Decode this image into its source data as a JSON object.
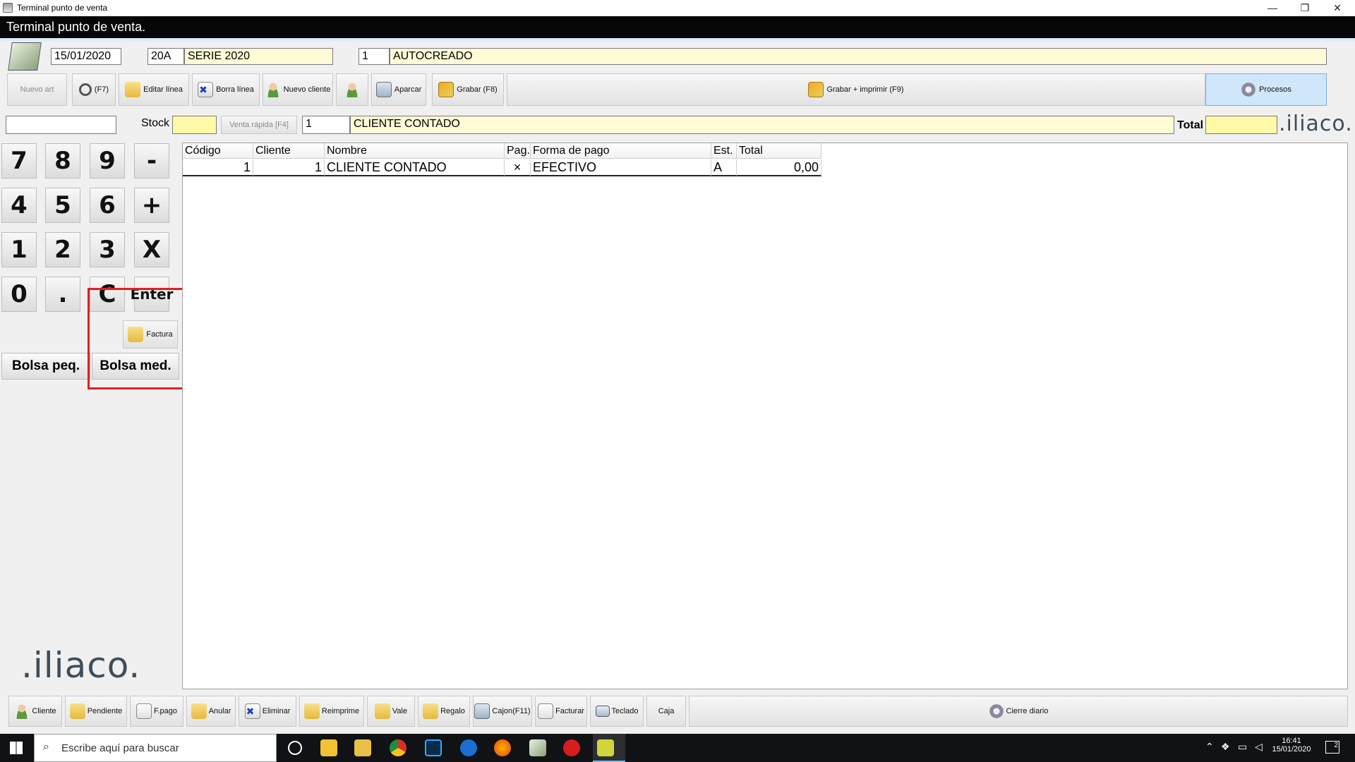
{
  "window": {
    "title": "Terminal punto de venta",
    "minimize": "—",
    "restore": "❐",
    "close": "✕"
  },
  "header": {
    "title": "Terminal punto de venta."
  },
  "doc": {
    "date": "15/01/2020",
    "serie_code": "20A",
    "serie_name": "SERIE 2020",
    "number": "1",
    "status_text": "AUTOCREADO"
  },
  "toolbar": {
    "nuevo_art": "Nuevo art",
    "f7": "(F7)",
    "editar_linea": "Editar línea",
    "borra_linea": "Borra línea",
    "nuevo_cliente": "Nuevo cliente",
    "aparcar": "Aparcar",
    "grabar": "Grabar (F8)",
    "grabar_imprimir": "Grabar + imprimir (F9)",
    "procesos": "Procesos"
  },
  "row2": {
    "code_value": "",
    "stock_label": "Stock",
    "stock_value": "",
    "venta_rapida": "Venta rápida [F4]",
    "client_code": "1",
    "client_name": "CLIENTE CONTADO",
    "total_label": "Total",
    "total_value": "",
    "logo": ".iliaco."
  },
  "keypad": {
    "keys": [
      "7",
      "8",
      "9",
      "-",
      "4",
      "5",
      "6",
      "+",
      "1",
      "2",
      "3",
      "X",
      "0",
      ".",
      "C",
      "Enter"
    ],
    "factura": "Factura",
    "bolsa_peq": "Bolsa peq.",
    "bolsa_med": "Bolsa med."
  },
  "grid": {
    "headers": [
      "Código",
      "Cliente",
      "Nombre",
      "Pag.",
      "Forma de pago",
      "Est.",
      "Total"
    ],
    "rows": [
      {
        "codigo": "1",
        "cliente": "1",
        "nombre": "CLIENTE CONTADO",
        "pag": "×",
        "forma": "EFECTIVO",
        "est": "A",
        "total": "0,00"
      }
    ]
  },
  "left_logo": ".iliaco.",
  "bottom": {
    "cliente": "Cliente",
    "pendiente": "Pendiente",
    "fpago": "F.pago",
    "anular": "Anular",
    "eliminar": "Eliminar",
    "reimprime": "Reimprime",
    "vale": "Vale",
    "regalo": "Regalo",
    "cajon": "Cajon(F11)",
    "facturar": "Facturar",
    "teclado": "Teclado",
    "caja": "Caja",
    "cierre": "Cierre diario"
  },
  "taskbar": {
    "search_placeholder": "Escribe aquí para buscar",
    "time": "16:41",
    "date": "15/01/2020",
    "notif": "2"
  },
  "colors": {
    "highlight_box": "#e02020",
    "yellow": "#fffaa8",
    "header_bg": "#070707"
  }
}
